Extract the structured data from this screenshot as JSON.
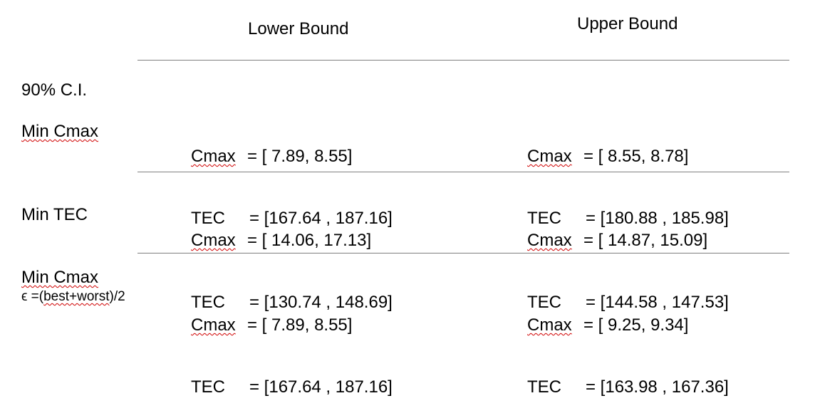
{
  "columns": {
    "lower": "Lower Bound",
    "upper": "Upper Bound"
  },
  "section_label": "90% C.I.",
  "rows": [
    {
      "label": "Min Cmax",
      "lower": {
        "cmax_label": "Cmax",
        "cmax_value": "= [ 7.89, 8.55]",
        "tec_label": "TEC",
        "tec_value": "= [167.64 , 187.16]"
      },
      "upper": {
        "cmax_label": "Cmax",
        "cmax_value": "= [ 8.55, 8.78]",
        "tec_label": "TEC",
        "tec_value": "= [180.88 , 185.98]"
      }
    },
    {
      "label": "Min TEC",
      "lower": {
        "cmax_label": "Cmax",
        "cmax_value": "= [ 14.06, 17.13]",
        "tec_label": "TEC",
        "tec_value": "= [130.74 , 148.69]"
      },
      "upper": {
        "cmax_label": "Cmax",
        "cmax_value": "= [ 14.87, 15.09]",
        "tec_label": "TEC",
        "tec_value": "= [144.58 , 147.53]"
      }
    },
    {
      "label": "Min Cmax",
      "sublabel_prefix": "ϵ =(",
      "sublabel_word": "best+worst",
      "sublabel_suffix": ")/2",
      "lower": {
        "cmax_label": "Cmax",
        "cmax_value": "= [ 7.89, 8.55]",
        "tec_label": "TEC",
        "tec_value": "= [167.64 , 187.16]"
      },
      "upper": {
        "cmax_label": "Cmax",
        "cmax_value": "= [ 9.25, 9.34]",
        "tec_label": "TEC",
        "tec_value": "= [163.98 , 167.36]"
      }
    }
  ]
}
